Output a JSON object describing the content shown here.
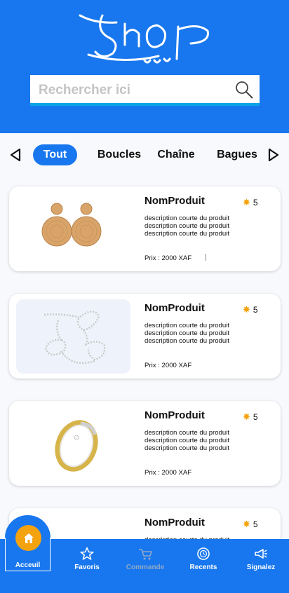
{
  "search": {
    "placeholder": "Rechercher ici"
  },
  "tabs": [
    {
      "label": "Tout",
      "active": true
    },
    {
      "label": "Boucles"
    },
    {
      "label": "Chaîne"
    },
    {
      "label": "Bagues"
    }
  ],
  "products": [
    {
      "name": "NomProduit",
      "rating": "5",
      "desc": [
        "description courte du produit",
        "description courte du produit",
        "description courte du produit"
      ],
      "price": "Prix : 2000 XAF",
      "image": "earrings"
    },
    {
      "name": "NomProduit",
      "rating": "5",
      "desc": [
        "description courte du produit",
        "description courte du produit",
        "description courte du produit"
      ],
      "price": "Prix : 2000 XAF",
      "image": "necklace"
    },
    {
      "name": "NomProduit",
      "rating": "5",
      "desc": [
        "description courte du produit",
        "description courte du produit",
        "description courte du produit"
      ],
      "price": "Prix : 2000 XAF",
      "image": "ring"
    },
    {
      "name": "NomProduit",
      "rating": "5",
      "desc": [
        "description courte du produit"
      ],
      "price": "",
      "image": ""
    }
  ],
  "nav": [
    {
      "label": "Acceuil",
      "icon": "home-icon",
      "active": true
    },
    {
      "label": "Favoris",
      "icon": "star-icon"
    },
    {
      "label": "Commande",
      "icon": "cart-icon",
      "disabled": true
    },
    {
      "label": "Recents",
      "icon": "clock-icon"
    },
    {
      "label": "Signalez",
      "icon": "megaphone-icon"
    }
  ],
  "colors": {
    "primary": "#1877ee",
    "accent": "#f4a20e",
    "star": "#f4a20e",
    "search_underline": "#0aa3e8"
  }
}
